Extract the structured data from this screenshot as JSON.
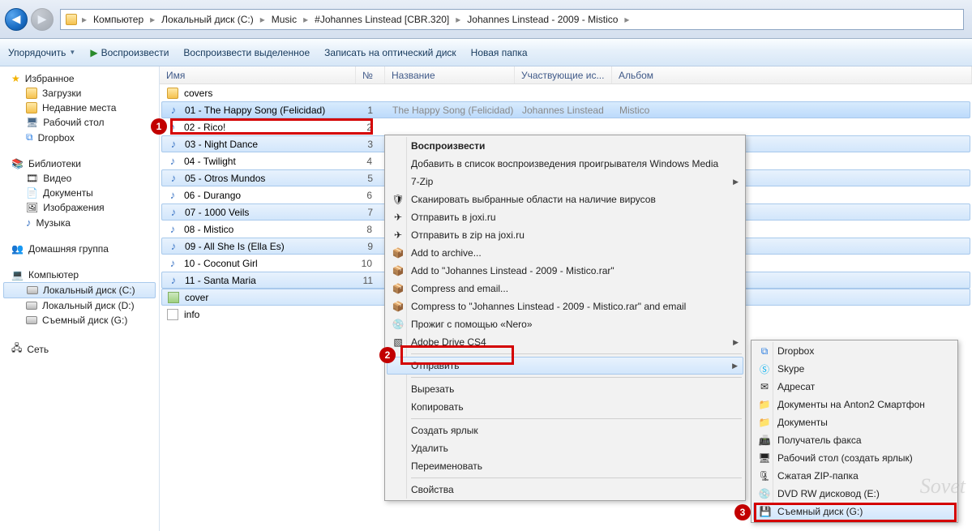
{
  "breadcrumbs": [
    "Компьютер",
    "Локальный диск (C:)",
    "Music",
    "#Johannes Linstead [CBR.320]",
    "Johannes Linstead - 2009 - Mistico"
  ],
  "toolbar": {
    "organize": "Упорядочить",
    "play": "Воспроизвести",
    "play_selected": "Воспроизвести выделенное",
    "burn": "Записать на оптический диск",
    "new_folder": "Новая папка"
  },
  "columns": {
    "name": "Имя",
    "num": "№",
    "title": "Название",
    "artist": "Участвующие ис...",
    "album": "Альбом"
  },
  "sidebar": {
    "favorites": {
      "label": "Избранное",
      "items": [
        "Загрузки",
        "Недавние места",
        "Рабочий стол",
        "Dropbox"
      ]
    },
    "libraries": {
      "label": "Библиотеки",
      "items": [
        "Видео",
        "Документы",
        "Изображения",
        "Музыка"
      ]
    },
    "homegroup": "Домашняя группа",
    "computer": {
      "label": "Компьютер",
      "items": [
        "Локальный диск (C:)",
        "Локальный диск (D:)",
        "Съемный диск (G:)"
      ]
    },
    "network": "Сеть"
  },
  "files": [
    {
      "type": "folder",
      "name": "covers",
      "sel": false
    },
    {
      "type": "music",
      "name": "01 - The Happy Song (Felicidad)",
      "num": "1",
      "title": "The Happy Song (Felicidad)",
      "artist": "Johannes Linstead",
      "album": "Mistico",
      "sel": true,
      "heavy": true
    },
    {
      "type": "music",
      "name": "02 - Rico!",
      "num": "2",
      "sel": false
    },
    {
      "type": "music",
      "name": "03 - Night Dance",
      "num": "3",
      "sel": true
    },
    {
      "type": "music",
      "name": "04 - Twilight",
      "num": "4",
      "sel": false
    },
    {
      "type": "music",
      "name": "05 - Otros Mundos",
      "num": "5",
      "sel": true
    },
    {
      "type": "music",
      "name": "06 - Durango",
      "num": "6",
      "sel": false
    },
    {
      "type": "music",
      "name": "07 - 1000 Veils",
      "num": "7",
      "sel": true
    },
    {
      "type": "music",
      "name": "08 - Mistico",
      "num": "8",
      "sel": false
    },
    {
      "type": "music",
      "name": "09 - All She Is (Ella Es)",
      "num": "9",
      "sel": true
    },
    {
      "type": "music",
      "name": "10 - Coconut Girl",
      "num": "10",
      "sel": false
    },
    {
      "type": "music",
      "name": "11 - Santa Maria",
      "num": "11",
      "sel": true
    },
    {
      "type": "image",
      "name": "cover",
      "sel": true
    },
    {
      "type": "text",
      "name": "info",
      "sel": false
    }
  ],
  "context_menu": {
    "play": "Воспроизвести",
    "add_wmp": "Добавить в список воспроизведения проигрывателя Windows Media",
    "sevenzip": "7-Zip",
    "scan": "Сканировать выбранные области на наличие вирусов",
    "joxi": "Отправить в joxi.ru",
    "joxi_zip": "Отправить в zip на joxi.ru",
    "add_archive": "Add to archive...",
    "add_rar": "Add to \"Johannes Linstead - 2009 - Mistico.rar\"",
    "compress_email": "Compress and email...",
    "compress_rar_email": "Compress to \"Johannes Linstead - 2009 - Mistico.rar\" and email",
    "nero": "Прожиг с помощью «Nero»",
    "adobe": "Adobe Drive CS4",
    "send_to": "Отправить",
    "cut": "Вырезать",
    "copy": "Копировать",
    "shortcut": "Создать ярлык",
    "delete": "Удалить",
    "rename": "Переименовать",
    "properties": "Свойства"
  },
  "send_to_menu": {
    "dropbox": "Dropbox",
    "skype": "Skype",
    "recipient": "Адресат",
    "docs_phone": "Документы на Anton2 Смартфон",
    "docs": "Документы",
    "fax": "Получатель факса",
    "desktop_link": "Рабочий стол (создать ярлык)",
    "zip": "Сжатая ZIP-папка",
    "dvd": "DVD RW дисковод (E:)",
    "removable": "Съемный диск (G:)"
  },
  "callouts": {
    "c1": "1",
    "c2": "2",
    "c3": "3"
  },
  "watermark": "Sovet"
}
